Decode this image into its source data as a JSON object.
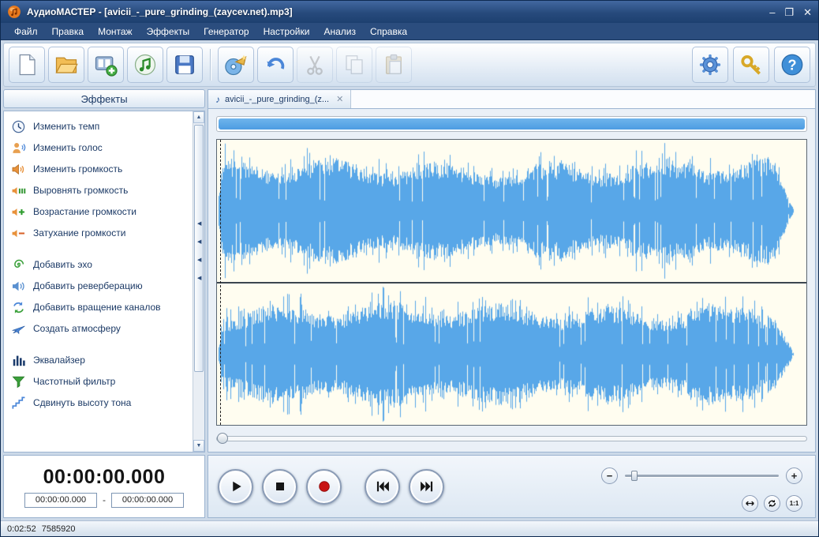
{
  "colors": {
    "accent_blue": "#58a7e8",
    "waveform_bg": "#fffdf0",
    "record_red": "#c81414"
  },
  "window": {
    "title": "АудиоМАСТЕР - [avicii_-_pure_grinding_(zaycev.net).mp3]",
    "minimize_label": "–",
    "maximize_label": "❐",
    "close_label": "✕"
  },
  "menu": {
    "items": [
      {
        "name": "file",
        "label": "Файл"
      },
      {
        "name": "edit",
        "label": "Правка"
      },
      {
        "name": "montage",
        "label": "Монтаж"
      },
      {
        "name": "effects",
        "label": "Эффекты"
      },
      {
        "name": "generator",
        "label": "Генератор"
      },
      {
        "name": "settings",
        "label": "Настройки"
      },
      {
        "name": "analysis",
        "label": "Анализ"
      },
      {
        "name": "help",
        "label": "Справка"
      }
    ]
  },
  "toolbar": {
    "left": [
      {
        "name": "new-file-button",
        "icon": "doc-new",
        "enabled": true
      },
      {
        "name": "open-file-button",
        "icon": "folder-open",
        "enabled": true
      },
      {
        "name": "extract-from-video-button",
        "icon": "film-add",
        "enabled": true
      },
      {
        "name": "save-sound-button",
        "icon": "music-note",
        "enabled": true
      },
      {
        "name": "save-file-button",
        "icon": "save",
        "enabled": true
      },
      {
        "sep": true
      },
      {
        "name": "record-sound-button",
        "icon": "cd-horn",
        "enabled": true
      },
      {
        "name": "undo-button",
        "icon": "undo",
        "enabled": true
      },
      {
        "name": "cut-button",
        "icon": "cut",
        "enabled": false
      },
      {
        "name": "copy-button",
        "icon": "copy",
        "enabled": false
      },
      {
        "name": "paste-button",
        "icon": "paste",
        "enabled": false
      }
    ],
    "right": [
      {
        "name": "settings-button",
        "icon": "gear",
        "enabled": true
      },
      {
        "name": "key-button",
        "icon": "key",
        "enabled": true
      },
      {
        "name": "help-button",
        "icon": "help",
        "enabled": true
      }
    ]
  },
  "sidebar": {
    "header": "Эффекты",
    "items": [
      {
        "name": "change-tempo",
        "icon": "tempo",
        "label": "Изменить темп"
      },
      {
        "name": "change-voice",
        "icon": "voice",
        "label": "Изменить голос"
      },
      {
        "name": "change-volume",
        "icon": "volume",
        "label": "Изменить громкость"
      },
      {
        "name": "normalize-volume",
        "icon": "normalize",
        "label": "Выровнять громкость"
      },
      {
        "name": "volume-fade-in",
        "icon": "fade-in",
        "label": "Возрастание громкости"
      },
      {
        "name": "volume-fade-out",
        "icon": "fade-out",
        "label": "Затухание громкости"
      },
      {
        "name": "add-echo",
        "icon": "echo",
        "label": "Добавить эхо",
        "gap_before": true
      },
      {
        "name": "add-reverb",
        "icon": "reverb",
        "label": "Добавить реверберацию"
      },
      {
        "name": "add-channel-rotation",
        "icon": "rotate",
        "label": "Добавить вращение каналов"
      },
      {
        "name": "create-atmosphere",
        "icon": "atmosphere",
        "label": "Создать атмосферу"
      },
      {
        "name": "equalizer",
        "icon": "equalizer",
        "label": "Эквалайзер",
        "gap_before": true
      },
      {
        "name": "frequency-filter",
        "icon": "filter",
        "label": "Частотный фильтр"
      },
      {
        "name": "shift-pitch",
        "icon": "pitch",
        "label": "Сдвинуть высоту тона"
      }
    ]
  },
  "tab": {
    "label": "avicii_-_pure_grinding_(z...",
    "close_label": "✕",
    "icon": "audio-note"
  },
  "time_panel": {
    "current": "00:00:00.000",
    "sel_start": "00:00:00.000",
    "separator": "-",
    "sel_end": "00:00:00.000"
  },
  "transport": {
    "buttons": [
      {
        "name": "play-button",
        "icon": "play"
      },
      {
        "name": "stop-button",
        "icon": "stop"
      },
      {
        "name": "record-button",
        "icon": "record"
      },
      {
        "name": "skip-start-button",
        "icon": "skip-start",
        "gap_before": true
      },
      {
        "name": "skip-end-button",
        "icon": "skip-end"
      }
    ],
    "zoom": {
      "minus": "−",
      "plus": "+",
      "one_to_one": "1:1"
    }
  },
  "status_bar": {
    "duration": "0:02:52",
    "size": "7585920"
  }
}
